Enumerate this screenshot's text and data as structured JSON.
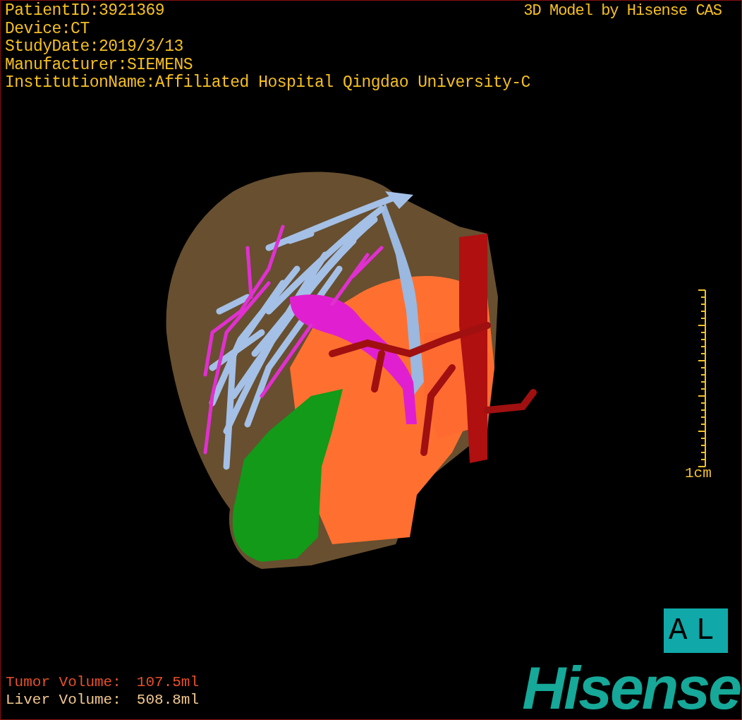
{
  "header": {
    "lines": [
      "PatientID:3921369",
      "Device:CT",
      "StudyDate:2019/3/13",
      "Manufacturer:SIEMENS",
      "InstitutionName:Affiliated Hospital Qingdao University-C"
    ],
    "credit": "3D Model by Hisense CAS"
  },
  "scale_bar": {
    "label": "1cm"
  },
  "orientation": {
    "label": "AL"
  },
  "volumes": [
    {
      "label": "Tumor Volume:",
      "value": "107.5ml",
      "color": "#e8502a"
    },
    {
      "label": "Liver Volume:",
      "value": "508.8ml",
      "color": "#f2c88e"
    }
  ],
  "logo": {
    "text": "Hisense"
  }
}
